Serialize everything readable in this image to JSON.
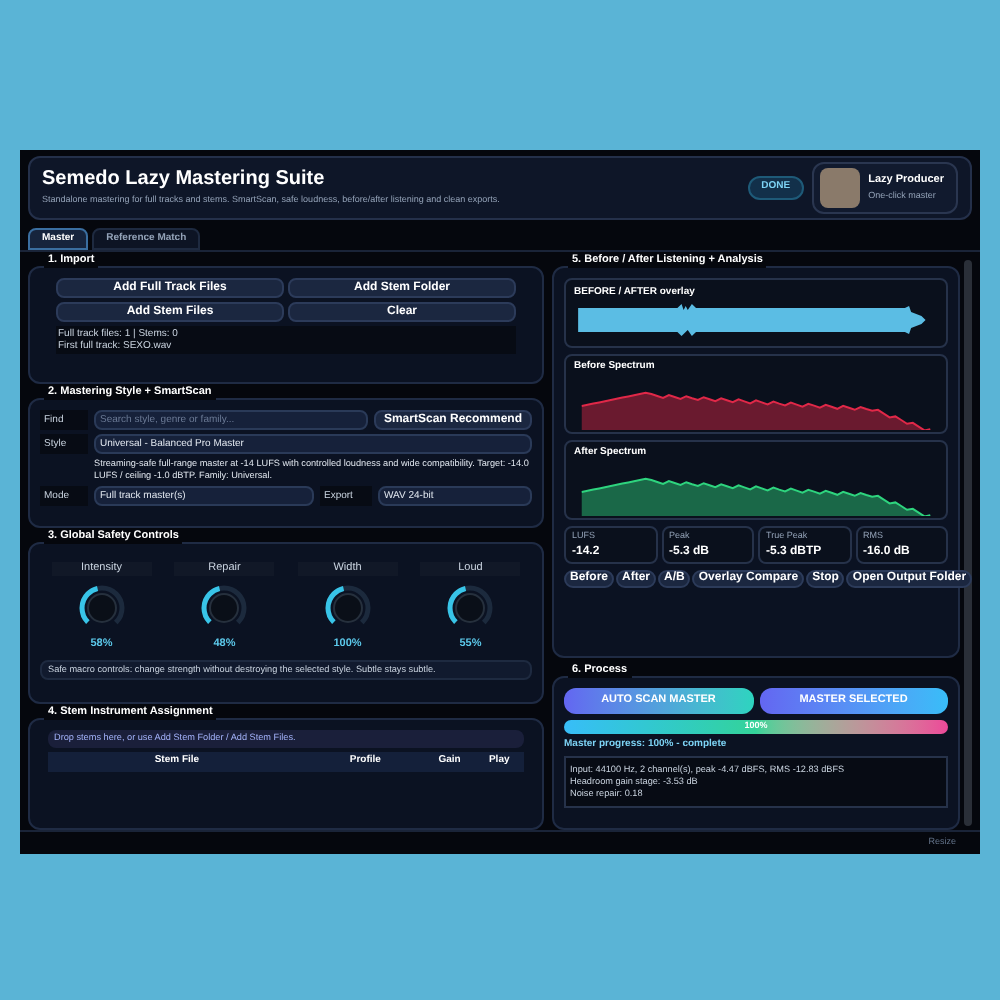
{
  "header": {
    "title": "Semedo Lazy Mastering Suite",
    "subtitle": "Standalone mastering for full tracks and stems. SmartScan, safe loudness, before/after listening and clean exports.",
    "done_button": "DONE",
    "profile": {
      "name": "Lazy Producer",
      "tagline": "One-click master"
    }
  },
  "tabs": [
    {
      "label": "Master",
      "selected": true
    },
    {
      "label": "Reference Match",
      "selected": false
    }
  ],
  "import": {
    "title": "1. Import",
    "buttons": [
      "Add Full Track Files",
      "Add Stem Folder",
      "Add Stem Files",
      "Clear"
    ],
    "info": [
      "Full track files: 1  |  Stems: 0",
      "First full track: SEXO.wav"
    ]
  },
  "style": {
    "title": "2. Mastering Style + SmartScan",
    "find_label": "Find",
    "find_placeholder": "Search style, genre or family...",
    "recommend_button": "SmartScan Recommend",
    "style_label": "Style",
    "style_value": "Universal - Balanced Pro Master",
    "description": "Streaming-safe full-range master at -14 LUFS with controlled loudness and wide compatibility.  Target: -14.0 LUFS / ceiling -1.0 dBTP. Family: Universal.",
    "mode_label": "Mode",
    "mode_value": "Full track master(s)",
    "export_label": "Export",
    "export_value": "WAV 24-bit"
  },
  "safety": {
    "title": "3. Global Safety Controls",
    "knobs": [
      {
        "label": "Intensity",
        "value": "58%"
      },
      {
        "label": "Repair",
        "value": "48%"
      },
      {
        "label": "Width",
        "value": "100%"
      },
      {
        "label": "Loud",
        "value": "55%"
      }
    ],
    "note": "Safe macro controls: change strength without destroying the selected style. Subtle stays subtle."
  },
  "stems": {
    "title": "4. Stem Instrument Assignment",
    "hint": "Drop stems here, or use Add Stem Folder / Add Stem Files.",
    "columns": [
      "Stem File",
      "Profile",
      "Gain",
      "Play"
    ]
  },
  "analysis": {
    "title": "5. Before / After Listening + Analysis",
    "overlay_title": "BEFORE / AFTER overlay",
    "before_title": "Before Spectrum",
    "after_title": "After Spectrum",
    "meters": [
      {
        "label": "LUFS",
        "value": "-14.2"
      },
      {
        "label": "Peak",
        "value": "-5.3 dB"
      },
      {
        "label": "True Peak",
        "value": "-5.3 dBTP"
      },
      {
        "label": "RMS",
        "value": "-16.0 dB"
      }
    ],
    "buttons": [
      "Before",
      "After",
      "A/B",
      "Overlay Compare",
      "Stop",
      "Open Output Folder"
    ]
  },
  "process": {
    "title": "6. Process",
    "buttons": [
      "AUTO SCAN MASTER",
      "MASTER SELECTED"
    ],
    "progress": {
      "level": 1,
      "label": "100%"
    },
    "status": "Master progress: 100% - complete",
    "log": [
      "Input: 44100 Hz, 2 channel(s), peak -4.47 dBFS, RMS -12.83 dBFS",
      "Headroom gain stage: -3.53 dB",
      "Noise repair: 0.18"
    ]
  },
  "status_bar": {
    "resize": "Resize"
  }
}
